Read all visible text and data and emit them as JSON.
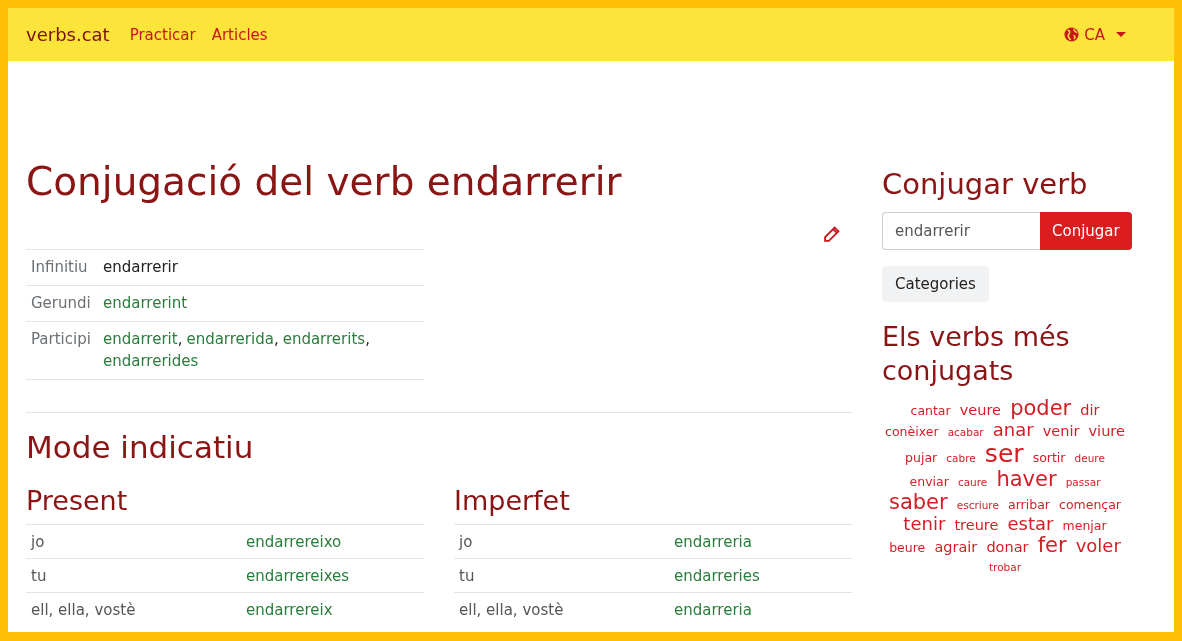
{
  "navbar": {
    "brand": "verbs.cat",
    "links": [
      "Practicar",
      "Articles"
    ],
    "language": "CA"
  },
  "title": "Conjugació del verb endarrerir",
  "forms": [
    {
      "label": "Infinitiu",
      "values": [
        {
          "text": "endarrerir",
          "link": false
        }
      ]
    },
    {
      "label": "Gerundi",
      "values": [
        {
          "text": "endarrerint",
          "link": true
        }
      ]
    },
    {
      "label": "Participi",
      "values": [
        {
          "text": "endarrerit",
          "link": true,
          "sep": ","
        },
        {
          "text": "endarrerida",
          "link": true,
          "sep": ","
        },
        {
          "text": "endarrerits",
          "link": true,
          "sep": ","
        },
        {
          "text": "endarrerides",
          "link": true
        }
      ]
    }
  ],
  "mode_title": "Mode indicatiu",
  "tenses": [
    {
      "name": "Present",
      "rows": [
        {
          "person": "jo",
          "form": "endarrereixo"
        },
        {
          "person": "tu",
          "form": "endarrereixes"
        },
        {
          "person": "ell, ella, vostè",
          "form": "endarrereix"
        }
      ]
    },
    {
      "name": "Imperfet",
      "rows": [
        {
          "person": "jo",
          "form": "endarreria"
        },
        {
          "person": "tu",
          "form": "endarreries"
        },
        {
          "person": "ell, ella, vostè",
          "form": "endarreria"
        }
      ]
    }
  ],
  "sidebar": {
    "title": "Conjugar verb",
    "search_value": "endarrerir",
    "button": "Conjugar",
    "categories": "Categories",
    "cloud_title": "Els verbs més conjugats",
    "cloud": [
      {
        "word": "cantar",
        "kind": "small"
      },
      {
        "word": "veure",
        "kind": "medium"
      },
      {
        "word": "poder",
        "kind": "huge"
      },
      {
        "word": "dir",
        "kind": "medium"
      },
      {
        "word": "conèixer",
        "kind": "small"
      },
      {
        "word": "acabar",
        "kind": "tiny"
      },
      {
        "word": "anar",
        "kind": "large"
      },
      {
        "word": "venir",
        "kind": "medium"
      },
      {
        "word": "viure",
        "kind": "medium"
      },
      {
        "word": "pujar",
        "kind": "small"
      },
      {
        "word": "cabre",
        "kind": "tiny"
      },
      {
        "word": "ser",
        "kind": "giant"
      },
      {
        "word": "sortir",
        "kind": "small"
      },
      {
        "word": "deure",
        "kind": "tiny"
      },
      {
        "word": "enviar",
        "kind": "small"
      },
      {
        "word": "caure",
        "kind": "tiny"
      },
      {
        "word": "haver",
        "kind": "huge"
      },
      {
        "word": "passar",
        "kind": "tiny"
      },
      {
        "word": "saber",
        "kind": "huge"
      },
      {
        "word": "escriure",
        "kind": "tiny"
      },
      {
        "word": "arribar",
        "kind": "small"
      },
      {
        "word": "començar",
        "kind": "small"
      },
      {
        "word": "tenir",
        "kind": "large"
      },
      {
        "word": "treure",
        "kind": "medium"
      },
      {
        "word": "estar",
        "kind": "large"
      },
      {
        "word": "menjar",
        "kind": "small"
      },
      {
        "word": "beure",
        "kind": "small"
      },
      {
        "word": "agrair",
        "kind": "medium"
      },
      {
        "word": "donar",
        "kind": "medium"
      },
      {
        "word": "fer",
        "kind": "huge"
      },
      {
        "word": "voler",
        "kind": "large"
      },
      {
        "word": "trobar",
        "kind": "tiny"
      }
    ]
  }
}
